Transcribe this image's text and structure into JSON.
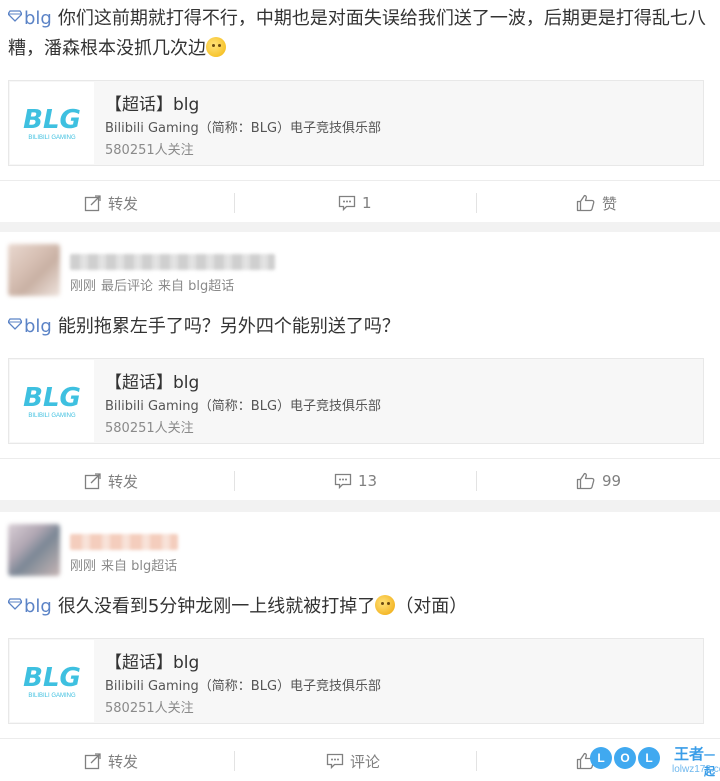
{
  "posts": [
    {
      "text": "你们这前期就打得不行，中期也是对面失误给我们送了一波，后期更是打得乱七八糟，潘森根本没抓几次边",
      "topic": "blg",
      "card": {
        "title": "【超话】blg",
        "desc": "Bilibili Gaming（简称：BLG）电子竞技俱乐部",
        "fans": "580251人关注"
      },
      "actions": {
        "repost": "转发",
        "comment": "1",
        "like": "赞"
      }
    },
    {
      "meta": [
        "刚刚",
        "最后评论",
        "来自 blg超话"
      ],
      "topic": "blg",
      "text": "能别拖累左手了吗？另外四个能别送了吗？",
      "card": {
        "title": "【超话】blg",
        "desc": "Bilibili Gaming（简称：BLG）电子竞技俱乐部",
        "fans": "580251人关注"
      },
      "actions": {
        "repost": "转发",
        "comment": "13",
        "like": "99"
      }
    },
    {
      "meta": [
        "刚刚",
        "来自 blg超话"
      ],
      "topic": "blg",
      "text": "很久没看到5分钟龙刚一上线就被打掉了",
      "text_suffix": "（对面）",
      "card": {
        "title": "【超话】blg",
        "desc": "Bilibili Gaming（简称：BLG）电子竞技俱乐部",
        "fans": "580251人关注"
      },
      "actions": {
        "repost": "转发",
        "comment": "评论"
      }
    }
  ],
  "logo": {
    "main": "BLG",
    "sub": "BILIBILI GAMING"
  },
  "watermark": {
    "letters": [
      "L",
      "O",
      "L"
    ],
    "brand": "王者",
    "tag": "一起上",
    "url": "lolwz173.com"
  },
  "colors": {
    "topic": "#5b83c6",
    "logo_blue": "#3ec0e0",
    "watermark": "#3a9de8"
  }
}
